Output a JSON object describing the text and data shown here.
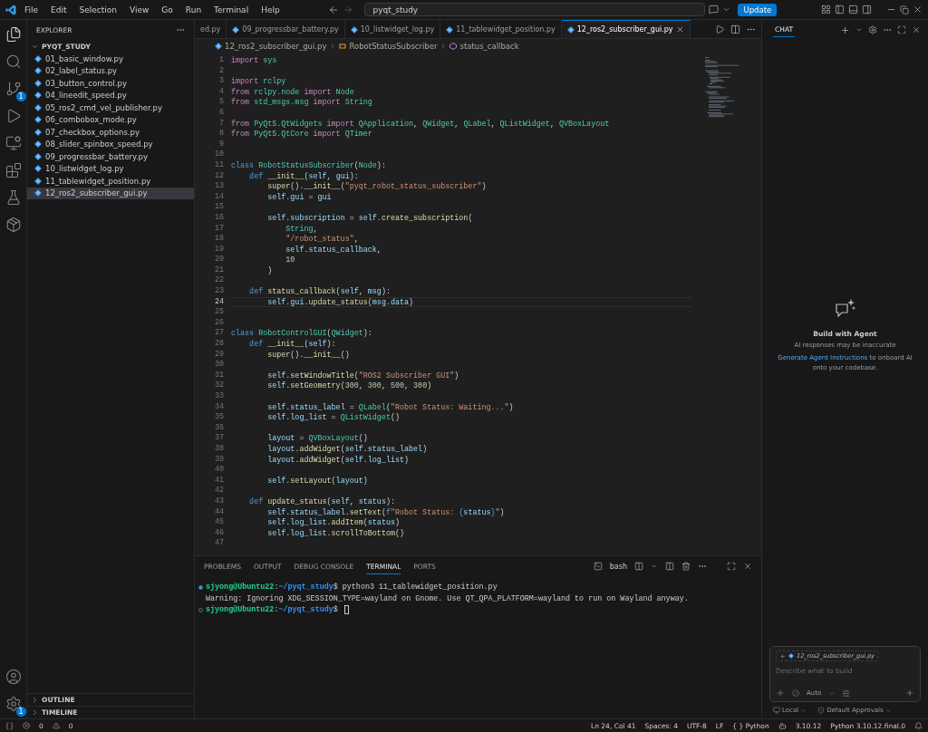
{
  "title_bar": {
    "menus": [
      "File",
      "Edit",
      "Selection",
      "View",
      "Go",
      "Run",
      "Terminal",
      "Help"
    ],
    "search": {
      "value": "pyqt_study"
    },
    "update_button": "Update"
  },
  "activity_bar": {
    "source_control_badge": "1",
    "settings_badge": "1"
  },
  "sidebar": {
    "title": "EXPLORER",
    "folder": {
      "name": "PYQT_STUDY",
      "expanded": true,
      "files": [
        {
          "name": "01_basic_window.py",
          "selected": false
        },
        {
          "name": "02_label_status.py",
          "selected": false
        },
        {
          "name": "03_button_control.py",
          "selected": false
        },
        {
          "name": "04_lineedit_speed.py",
          "selected": false
        },
        {
          "name": "05_ros2_cmd_vel_publisher.py",
          "selected": false
        },
        {
          "name": "06_combobox_mode.py",
          "selected": false
        },
        {
          "name": "07_checkbox_options.py",
          "selected": false
        },
        {
          "name": "08_slider_spinbox_speed.py",
          "selected": false
        },
        {
          "name": "09_progressbar_battery.py",
          "selected": false
        },
        {
          "name": "10_listwidget_log.py",
          "selected": false
        },
        {
          "name": "11_tablewidget_position.py",
          "selected": false
        },
        {
          "name": "12_ros2_subscriber_gui.py",
          "selected": true
        }
      ]
    },
    "sections": [
      {
        "name": "OUTLINE",
        "expanded": false
      },
      {
        "name": "TIMELINE",
        "expanded": false
      }
    ]
  },
  "tabs": [
    {
      "label": "ed.py",
      "selected": false
    },
    {
      "label": "09_progressbar_battery.py",
      "selected": false
    },
    {
      "label": "10_listwidget_log.py",
      "selected": false
    },
    {
      "label": "11_tablewidget_position.py",
      "selected": false
    },
    {
      "label": "12_ros2_subscriber_gui.py",
      "selected": true
    }
  ],
  "breadcrumb": [
    {
      "kind": "file",
      "label": "12_ros2_subscriber_gui.py"
    },
    {
      "kind": "class",
      "label": "RobotStatusSubscriber"
    },
    {
      "kind": "method",
      "label": "status_callback"
    }
  ],
  "code": [
    {
      "number": "1",
      "current": false,
      "tokens": [
        {
          "kind": "ctl",
          "text": "import"
        },
        {
          "kind": "cls",
          "text": " sys"
        }
      ]
    },
    {
      "number": "2",
      "current": false
    },
    {
      "number": "3",
      "current": false,
      "tokens": [
        {
          "kind": "ctl",
          "text": "import"
        },
        {
          "kind": "cls",
          "text": " rclpy"
        }
      ]
    },
    {
      "number": "4",
      "current": false,
      "tokens": [
        {
          "kind": "ctl",
          "text": "from"
        },
        {
          "kind": "cls",
          "text": " rclpy.node"
        },
        {
          "kind": "ctl",
          "text": " import"
        },
        {
          "kind": "cls",
          "text": " Node"
        }
      ]
    },
    {
      "number": "5",
      "current": false,
      "tokens": [
        {
          "kind": "ctl",
          "text": "from"
        },
        {
          "kind": "cls",
          "text": " std_msgs.msg"
        },
        {
          "kind": "ctl",
          "text": " import"
        },
        {
          "kind": "cls",
          "text": " String"
        }
      ]
    },
    {
      "number": "6",
      "current": false
    },
    {
      "number": "7",
      "current": false,
      "tokens": [
        {
          "kind": "ctl",
          "text": "from"
        },
        {
          "kind": "cls",
          "text": " PyQt5.QtWidgets"
        },
        {
          "kind": "ctl",
          "text": " import"
        },
        {
          "kind": "cls",
          "text": " QApplication"
        },
        {
          "kind": "p",
          "text": ", "
        },
        {
          "kind": "cls",
          "text": "QWidget"
        },
        {
          "kind": "p",
          "text": ", "
        },
        {
          "kind": "cls",
          "text": "QLabel"
        },
        {
          "kind": "p",
          "text": ", "
        },
        {
          "kind": "cls",
          "text": "QListWidget"
        },
        {
          "kind": "p",
          "text": ", "
        },
        {
          "kind": "cls",
          "text": "QVBoxLayout"
        }
      ]
    },
    {
      "number": "8",
      "current": false,
      "tokens": [
        {
          "kind": "ctl",
          "text": "from"
        },
        {
          "kind": "cls",
          "text": " PyQt5.QtCore"
        },
        {
          "kind": "ctl",
          "text": " import"
        },
        {
          "kind": "cls",
          "text": " QTimer"
        }
      ]
    },
    {
      "number": "9",
      "current": false
    },
    {
      "number": "10",
      "current": false
    },
    {
      "number": "11",
      "current": false,
      "tokens": [
        {
          "kind": "kw",
          "text": "class"
        },
        {
          "kind": "cls",
          "text": " RobotStatusSubscriber"
        },
        {
          "kind": "p",
          "text": "("
        },
        {
          "kind": "cls",
          "text": "Node"
        },
        {
          "kind": "p",
          "text": "):"
        }
      ]
    },
    {
      "number": "12",
      "current": false,
      "tokens": [
        {
          "kind": "kw",
          "text": "    def"
        },
        {
          "kind": "fn",
          "text": " __init__"
        },
        {
          "kind": "p",
          "text": "("
        },
        {
          "kind": "var",
          "text": "self"
        },
        {
          "kind": "p",
          "text": ", "
        },
        {
          "kind": "var",
          "text": "gui"
        },
        {
          "kind": "p",
          "text": "):"
        }
      ]
    },
    {
      "number": "13",
      "current": false,
      "tokens": [
        {
          "kind": "fn",
          "text": "        super"
        },
        {
          "kind": "p",
          "text": "()."
        },
        {
          "kind": "fn",
          "text": "__init__"
        },
        {
          "kind": "p",
          "text": "("
        },
        {
          "kind": "str",
          "text": "\"pyqt_robot_status_subscriber\""
        },
        {
          "kind": "p",
          "text": ")"
        }
      ]
    },
    {
      "number": "14",
      "current": false,
      "tokens": [
        {
          "kind": "var",
          "text": "        self"
        },
        {
          "kind": "p",
          "text": "."
        },
        {
          "kind": "var",
          "text": "gui"
        },
        {
          "kind": "p",
          "text": " = "
        },
        {
          "kind": "var",
          "text": "gui"
        }
      ]
    },
    {
      "number": "15",
      "current": false
    },
    {
      "number": "16",
      "current": false,
      "tokens": [
        {
          "kind": "var",
          "text": "        self"
        },
        {
          "kind": "p",
          "text": "."
        },
        {
          "kind": "var",
          "text": "subscription"
        },
        {
          "kind": "p",
          "text": " = "
        },
        {
          "kind": "var",
          "text": "self"
        },
        {
          "kind": "p",
          "text": "."
        },
        {
          "kind": "fn",
          "text": "create_subscription"
        },
        {
          "kind": "p",
          "text": "("
        }
      ]
    },
    {
      "number": "17",
      "current": false,
      "tokens": [
        {
          "kind": "cls",
          "text": "            String"
        },
        {
          "kind": "p",
          "text": ","
        }
      ]
    },
    {
      "number": "18",
      "current": false,
      "tokens": [
        {
          "kind": "str",
          "text": "            \"/robot_status\""
        },
        {
          "kind": "p",
          "text": ","
        }
      ]
    },
    {
      "number": "19",
      "current": false,
      "tokens": [
        {
          "kind": "var",
          "text": "            self.status_callback"
        },
        {
          "kind": "p",
          "text": ","
        }
      ]
    },
    {
      "number": "20",
      "current": false,
      "tokens": [
        {
          "kind": "num",
          "text": "            10"
        }
      ]
    },
    {
      "number": "21",
      "current": false,
      "tokens": [
        {
          "kind": "p",
          "text": "        )"
        }
      ]
    },
    {
      "number": "22",
      "current": false
    },
    {
      "number": "23",
      "current": false,
      "tokens": [
        {
          "kind": "kw",
          "text": "    def"
        },
        {
          "kind": "fn",
          "text": " status_callback"
        },
        {
          "kind": "p",
          "text": "("
        },
        {
          "kind": "var",
          "text": "self"
        },
        {
          "kind": "p",
          "text": ", "
        },
        {
          "kind": "var",
          "text": "msg"
        },
        {
          "kind": "p",
          "text": "):"
        }
      ]
    },
    {
      "number": "24",
      "current": true,
      "tokens": [
        {
          "kind": "var",
          "text": "        self"
        },
        {
          "kind": "p",
          "text": "."
        },
        {
          "kind": "var",
          "text": "gui"
        },
        {
          "kind": "p",
          "text": "."
        },
        {
          "kind": "fn",
          "text": "update_status"
        },
        {
          "kind": "p",
          "text": "("
        },
        {
          "kind": "var",
          "text": "msg"
        },
        {
          "kind": "p",
          "text": "."
        },
        {
          "kind": "var",
          "text": "data"
        },
        {
          "kind": "p",
          "text": ")"
        }
      ]
    },
    {
      "number": "25",
      "current": false
    },
    {
      "number": "26",
      "current": false
    },
    {
      "number": "27",
      "current": false,
      "tokens": [
        {
          "kind": "kw",
          "text": "class"
        },
        {
          "kind": "cls",
          "text": " RobotControlGUI"
        },
        {
          "kind": "p",
          "text": "("
        },
        {
          "kind": "cls",
          "text": "QWidget"
        },
        {
          "kind": "p",
          "text": "):"
        }
      ]
    },
    {
      "number": "28",
      "current": false,
      "tokens": [
        {
          "kind": "kw",
          "text": "    def"
        },
        {
          "kind": "fn",
          "text": " __init__"
        },
        {
          "kind": "p",
          "text": "("
        },
        {
          "kind": "var",
          "text": "self"
        },
        {
          "kind": "p",
          "text": "):"
        }
      ]
    },
    {
      "number": "29",
      "current": false,
      "tokens": [
        {
          "kind": "fn",
          "text": "        super"
        },
        {
          "kind": "p",
          "text": "()."
        },
        {
          "kind": "fn",
          "text": "__init__"
        },
        {
          "kind": "p",
          "text": "()"
        }
      ]
    },
    {
      "number": "30",
      "current": false
    },
    {
      "number": "31",
      "current": false,
      "tokens": [
        {
          "kind": "var",
          "text": "        self"
        },
        {
          "kind": "p",
          "text": "."
        },
        {
          "kind": "fn",
          "text": "setWindowTitle"
        },
        {
          "kind": "p",
          "text": "("
        },
        {
          "kind": "str",
          "text": "\"ROS2 Subscriber GUI\""
        },
        {
          "kind": "p",
          "text": ")"
        }
      ]
    },
    {
      "number": "32",
      "current": false,
      "tokens": [
        {
          "kind": "var",
          "text": "        self"
        },
        {
          "kind": "p",
          "text": "."
        },
        {
          "kind": "fn",
          "text": "setGeometry"
        },
        {
          "kind": "p",
          "text": "("
        },
        {
          "kind": "num",
          "text": "300"
        },
        {
          "kind": "p",
          "text": ", "
        },
        {
          "kind": "num",
          "text": "300"
        },
        {
          "kind": "p",
          "text": ", "
        },
        {
          "kind": "num",
          "text": "500"
        },
        {
          "kind": "p",
          "text": ", "
        },
        {
          "kind": "num",
          "text": "300"
        },
        {
          "kind": "p",
          "text": ")"
        }
      ]
    },
    {
      "number": "33",
      "current": false
    },
    {
      "number": "34",
      "current": false,
      "tokens": [
        {
          "kind": "var",
          "text": "        self"
        },
        {
          "kind": "p",
          "text": "."
        },
        {
          "kind": "var",
          "text": "status_label"
        },
        {
          "kind": "p",
          "text": " = "
        },
        {
          "kind": "cls",
          "text": "QLabel"
        },
        {
          "kind": "p",
          "text": "("
        },
        {
          "kind": "str",
          "text": "\"Robot Status: Waiting...\""
        },
        {
          "kind": "p",
          "text": ")"
        }
      ]
    },
    {
      "number": "35",
      "current": false,
      "tokens": [
        {
          "kind": "var",
          "text": "        self"
        },
        {
          "kind": "p",
          "text": "."
        },
        {
          "kind": "var",
          "text": "log_list"
        },
        {
          "kind": "p",
          "text": " = "
        },
        {
          "kind": "cls",
          "text": "QListWidget"
        },
        {
          "kind": "p",
          "text": "()"
        }
      ]
    },
    {
      "number": "36",
      "current": false
    },
    {
      "number": "37",
      "current": false,
      "tokens": [
        {
          "kind": "var",
          "text": "        layout"
        },
        {
          "kind": "p",
          "text": " = "
        },
        {
          "kind": "cls",
          "text": "QVBoxLayout"
        },
        {
          "kind": "p",
          "text": "()"
        }
      ]
    },
    {
      "number": "38",
      "current": false,
      "tokens": [
        {
          "kind": "var",
          "text": "        layout"
        },
        {
          "kind": "p",
          "text": "."
        },
        {
          "kind": "fn",
          "text": "addWidget"
        },
        {
          "kind": "p",
          "text": "("
        },
        {
          "kind": "var",
          "text": "self"
        },
        {
          "kind": "p",
          "text": "."
        },
        {
          "kind": "var",
          "text": "status_label"
        },
        {
          "kind": "p",
          "text": ")"
        }
      ]
    },
    {
      "number": "39",
      "current": false,
      "tokens": [
        {
          "kind": "var",
          "text": "        layout"
        },
        {
          "kind": "p",
          "text": "."
        },
        {
          "kind": "fn",
          "text": "addWidget"
        },
        {
          "kind": "p",
          "text": "("
        },
        {
          "kind": "var",
          "text": "self"
        },
        {
          "kind": "p",
          "text": "."
        },
        {
          "kind": "var",
          "text": "log_list"
        },
        {
          "kind": "p",
          "text": ")"
        }
      ]
    },
    {
      "number": "40",
      "current": false
    },
    {
      "number": "41",
      "current": false,
      "tokens": [
        {
          "kind": "var",
          "text": "        self"
        },
        {
          "kind": "p",
          "text": "."
        },
        {
          "kind": "fn",
          "text": "setLayout"
        },
        {
          "kind": "p",
          "text": "("
        },
        {
          "kind": "var",
          "text": "layout"
        },
        {
          "kind": "p",
          "text": ")"
        }
      ]
    },
    {
      "number": "42",
      "current": false
    },
    {
      "number": "43",
      "current": false,
      "tokens": [
        {
          "kind": "kw",
          "text": "    def"
        },
        {
          "kind": "fn",
          "text": " update_status"
        },
        {
          "kind": "p",
          "text": "("
        },
        {
          "kind": "var",
          "text": "self"
        },
        {
          "kind": "p",
          "text": ", "
        },
        {
          "kind": "var",
          "text": "status"
        },
        {
          "kind": "p",
          "text": "):"
        }
      ]
    },
    {
      "number": "44",
      "current": false,
      "tokens": [
        {
          "kind": "var",
          "text": "        self"
        },
        {
          "kind": "p",
          "text": "."
        },
        {
          "kind": "var",
          "text": "status_label"
        },
        {
          "kind": "p",
          "text": "."
        },
        {
          "kind": "fn",
          "text": "setText"
        },
        {
          "kind": "p",
          "text": "("
        },
        {
          "kind": "kw",
          "text": "f"
        },
        {
          "kind": "str",
          "text": "\"Robot Status: "
        },
        {
          "kind": "kw",
          "text": "{"
        },
        {
          "kind": "var",
          "text": "status"
        },
        {
          "kind": "kw",
          "text": "}"
        },
        {
          "kind": "str",
          "text": "\""
        },
        {
          "kind": "p",
          "text": ")"
        }
      ]
    },
    {
      "number": "45",
      "current": false,
      "tokens": [
        {
          "kind": "var",
          "text": "        self"
        },
        {
          "kind": "p",
          "text": "."
        },
        {
          "kind": "var",
          "text": "log_list"
        },
        {
          "kind": "p",
          "text": "."
        },
        {
          "kind": "fn",
          "text": "addItem"
        },
        {
          "kind": "p",
          "text": "("
        },
        {
          "kind": "var",
          "text": "status"
        },
        {
          "kind": "p",
          "text": ")"
        }
      ]
    },
    {
      "number": "46",
      "current": false,
      "tokens": [
        {
          "kind": "var",
          "text": "        self"
        },
        {
          "kind": "p",
          "text": "."
        },
        {
          "kind": "var",
          "text": "log_list"
        },
        {
          "kind": "p",
          "text": "."
        },
        {
          "kind": "fn",
          "text": "scrollToBottom"
        },
        {
          "kind": "p",
          "text": "()"
        }
      ]
    },
    {
      "number": "47",
      "current": false
    }
  ],
  "panel": {
    "tabs": [
      {
        "label": "PROBLEMS",
        "selected": false
      },
      {
        "label": "OUTPUT",
        "selected": false
      },
      {
        "label": "DEBUG CONSOLE",
        "selected": false
      },
      {
        "label": "TERMINAL",
        "selected": true
      },
      {
        "label": "PORTS",
        "selected": false
      }
    ],
    "shell": "bash",
    "terminal": [
      {
        "kind": "done",
        "segments": [
          {
            "kind": "user",
            "text": "sjyong@Ubuntu22"
          },
          {
            "kind": "p",
            "text": ":"
          },
          {
            "kind": "path",
            "text": "~/pyqt_study"
          },
          {
            "kind": "p",
            "text": "$ python3 11_tablewidget_position.py"
          }
        ],
        "cursor": false
      },
      {
        "kind": "output",
        "segments": [
          {
            "kind": "p",
            "text": "Warning: Ignoring XDG_SESSION_TYPE=wayland on Gnome. Use QT_QPA_PLATFORM=wayland to run on Wayland anyway."
          }
        ],
        "cursor": false
      },
      {
        "kind": "pending",
        "segments": [
          {
            "kind": "user",
            "text": "sjyong@Ubuntu22"
          },
          {
            "kind": "p",
            "text": ":"
          },
          {
            "kind": "path",
            "text": "~/pyqt_study"
          },
          {
            "kind": "p",
            "text": "$"
          }
        ],
        "cursor": true
      }
    ]
  },
  "chat": {
    "tab": {
      "label": "CHAT",
      "selected": true
    },
    "heading": "Build with Agent",
    "note": "AI responses may be inaccurate",
    "link": "Generate Agent Instructions",
    "link_rest": "to onboard AI onto your codebase.",
    "attachment": "12_ros2_subscriber_gui.py",
    "input": {
      "placeholder": "Describe what to build"
    },
    "mode": "Auto",
    "location": "Local",
    "approvals": "Default Approvals"
  },
  "status_bar": {
    "errors": "0",
    "warnings": "0",
    "position": "Ln 24, Col 41",
    "spaces": "Spaces: 4",
    "encoding": "UTF-8",
    "eol": "LF",
    "braces": "{ }",
    "language": "Python",
    "version": "3.10.12",
    "interpreter": "Python 3.10.12.final.0"
  }
}
